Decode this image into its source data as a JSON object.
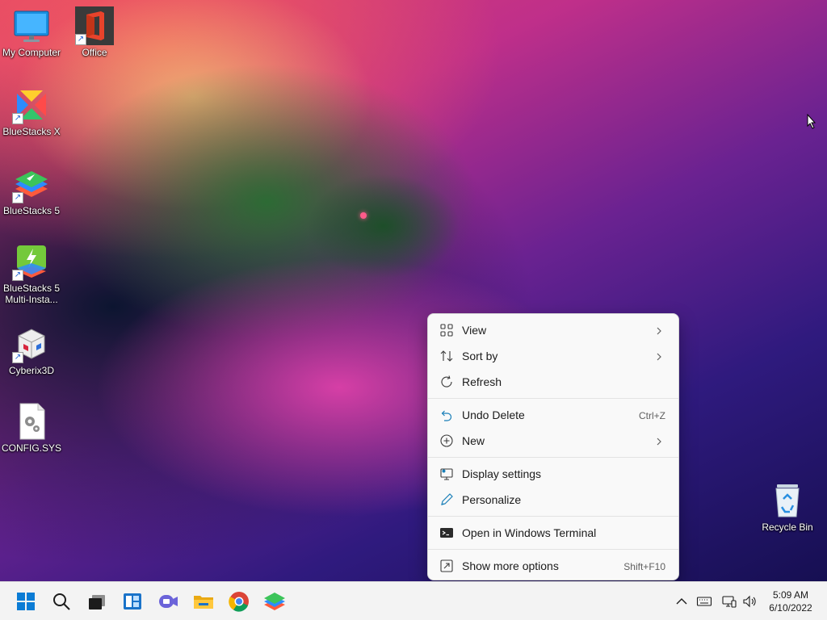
{
  "desktop": {
    "icons": [
      {
        "label": "My Computer"
      },
      {
        "label": "Office"
      },
      {
        "label": "BlueStacks X"
      },
      {
        "label": "BlueStacks 5"
      },
      {
        "label": "BlueStacks 5 Multi-Insta..."
      },
      {
        "label": "Cyberix3D"
      },
      {
        "label": "CONFIG.SYS"
      },
      {
        "label": "Recycle Bin"
      }
    ]
  },
  "context_menu": {
    "items": [
      {
        "label": "View",
        "icon": "view-grid-icon",
        "submenu": true
      },
      {
        "label": "Sort by",
        "icon": "sort-icon",
        "submenu": true
      },
      {
        "label": "Refresh",
        "icon": "refresh-icon"
      },
      {
        "label": "Undo Delete",
        "icon": "undo-icon",
        "shortcut": "Ctrl+Z"
      },
      {
        "label": "New",
        "icon": "new-plus-icon",
        "submenu": true
      },
      {
        "label": "Display settings",
        "icon": "display-settings-icon"
      },
      {
        "label": "Personalize",
        "icon": "pen-icon"
      },
      {
        "label": "Open in Windows Terminal",
        "icon": "terminal-icon"
      },
      {
        "label": "Show more options",
        "icon": "more-options-icon",
        "shortcut": "Shift+F10"
      }
    ]
  },
  "taskbar": {
    "apps": [
      "start-icon",
      "search-icon",
      "task-view-icon",
      "widgets-icon",
      "teams-chat-icon",
      "file-explorer-icon",
      "chrome-icon",
      "bluestacks-icon"
    ],
    "tray": [
      "chevron-up-icon",
      "keyboard-icon",
      "network-icon",
      "volume-icon"
    ],
    "clock": {
      "time": "5:09 AM",
      "date": "6/10/2022"
    }
  },
  "colors": {
    "menu_bg": "#f9f9f9",
    "taskbar_bg": "#f3f3f3",
    "accent": "#0067c0"
  }
}
